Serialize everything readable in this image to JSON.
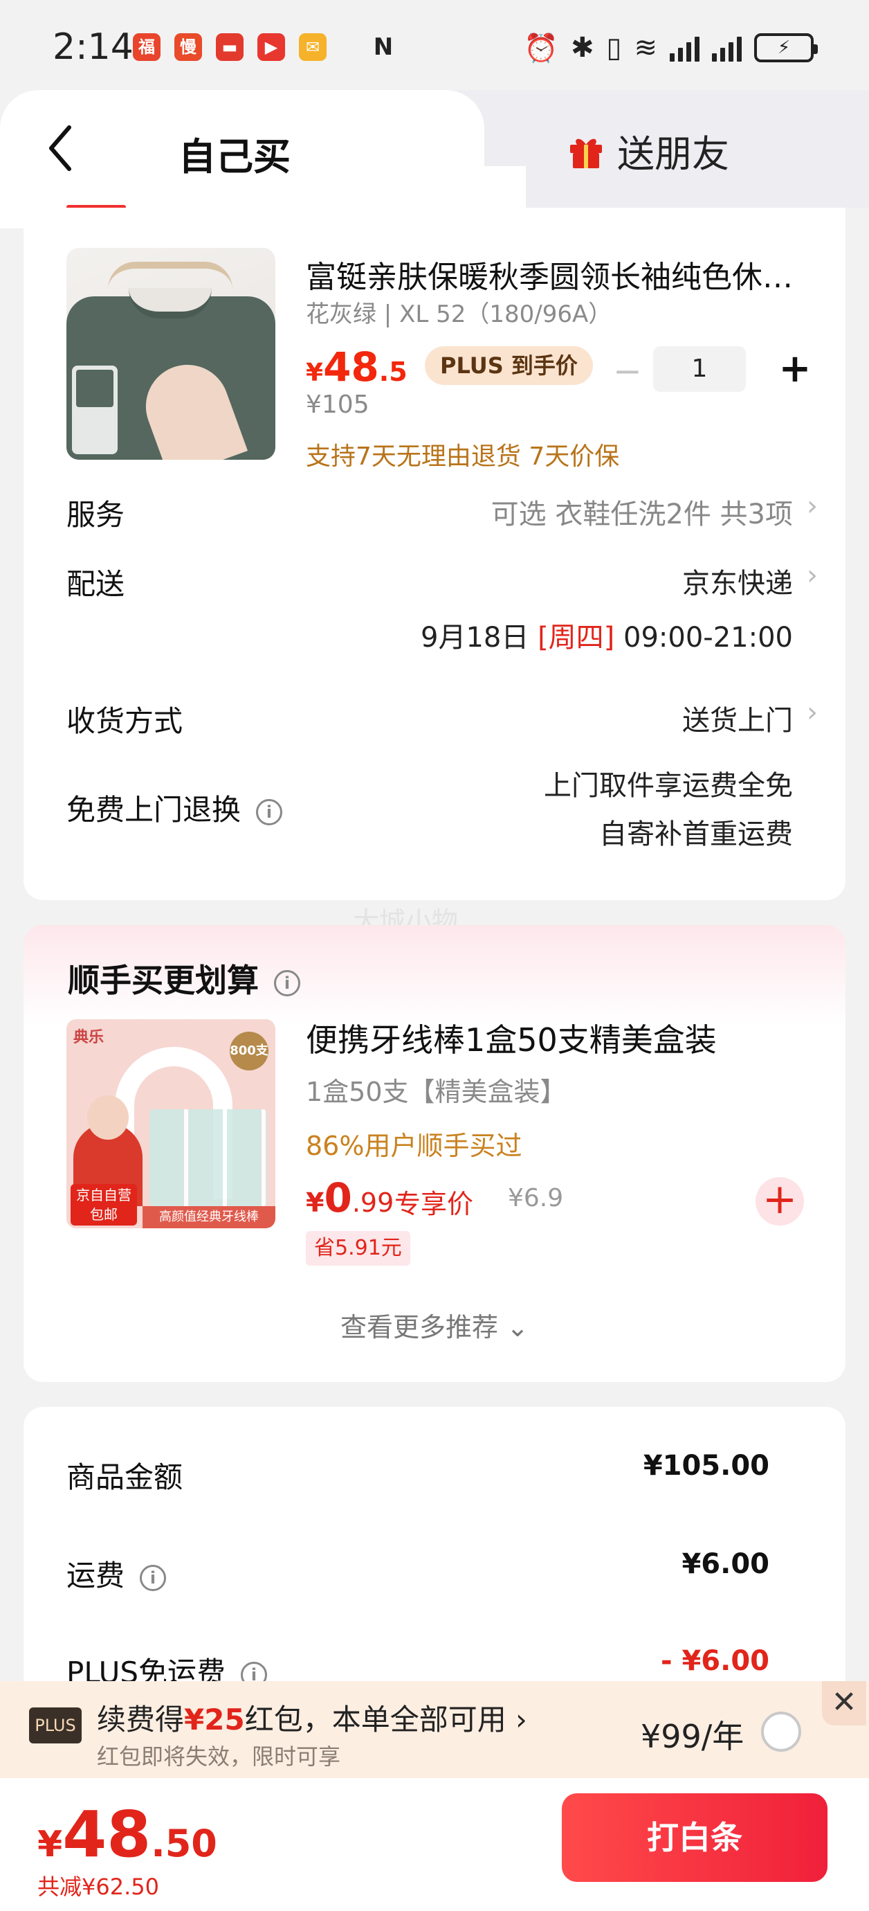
{
  "status_bar": {
    "time": "2:14",
    "app_icons": [
      {
        "name": "app-icon-1",
        "color": "#e8452c",
        "glyph": "福"
      },
      {
        "name": "app-icon-2",
        "color": "#e84a2a",
        "glyph": "慢"
      },
      {
        "name": "app-icon-3",
        "color": "#e33a2e",
        "glyph": "▬"
      },
      {
        "name": "app-icon-4",
        "color": "#e8372f",
        "glyph": "▶"
      },
      {
        "name": "app-icon-5",
        "color": "#f5b22a",
        "glyph": "✉"
      }
    ],
    "nfc_glyph": "N",
    "alarm_glyph": "⏰",
    "bluetooth_glyph": "✱",
    "vibrate_glyph": "▯",
    "wifi_glyph": "≋"
  },
  "tabs": {
    "self_buy": "自己买",
    "gift": "送朋友"
  },
  "product": {
    "title": "富铤亲肤保暖秋季圆领长袖纯色休闲针织衫",
    "spec": "花灰绿 | XL 52（180/96A）",
    "price_currency": "¥",
    "price_int": "48",
    "price_dec": ".5",
    "plus_badge": "PLUS 到手价",
    "original_price": "¥105",
    "support": "支持7天无理由退货  7天价保",
    "qty_minus": "−",
    "quantity": "1",
    "qty_plus": "+"
  },
  "rows": {
    "service_label": "服务",
    "service_value": "可选 衣鞋任洗2件 共3项",
    "delivery_label": "配送",
    "delivery_value": "京东快递",
    "date_prefix": "9月18日 ",
    "weekday": "[周四]",
    "time_window": " 09:00-21:00",
    "receive_label": "收货方式",
    "receive_value": "送货上门",
    "return_label": "免费上门退换",
    "return_line1": "上门取件享运费全免",
    "return_line2": "自寄补首重运费",
    "chevron": "›",
    "info": "i"
  },
  "watermark": "大城小物",
  "recommend": {
    "title": "顺手买更划算",
    "img_brand": "典乐",
    "img_badge": "800支",
    "img_tag": "京自自营 包邮",
    "img_strip": "高颜值经典牙线棒",
    "name": "便携牙线棒1盒50支精美盒装",
    "spec": "1盒50支【精美盒装】",
    "bought": "86%用户顺手买过",
    "price_currency": "¥",
    "price_int": "0",
    "price_dec": ".99",
    "exclusive": "专享价",
    "orig_price": "¥6.9",
    "save": "省5.91元",
    "add": "+",
    "more": "查看更多推荐 ⌄"
  },
  "amounts": {
    "goods_label": "商品金额",
    "goods_value": "¥105.00",
    "freight_label": "运费",
    "freight_value": "¥6.00",
    "plus_free_label": "PLUS免运费",
    "plus_free_value": "- ¥6.00"
  },
  "plus_banner": {
    "logo": "PLUS",
    "line1_prefix": "续费得",
    "line1_highlight": "¥25",
    "line1_suffix": "红包，本单全部可用 ›",
    "line2": "红包即将失效，限时可享",
    "price": "¥99/年",
    "close": "✕"
  },
  "bottom": {
    "total_currency": "¥",
    "total_int": "48",
    "total_dec": ".50",
    "saved": "共减¥62.50",
    "pay_button": "打白条"
  },
  "colors": {
    "accent_red": "#e1251b",
    "gold": "#b8741a",
    "plus_badge_bg": "#fbe4cf"
  }
}
